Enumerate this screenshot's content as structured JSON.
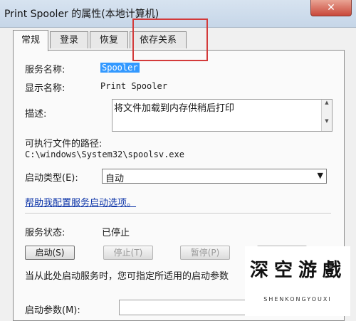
{
  "window": {
    "title": "Print Spooler 的属性(本地计算机)",
    "close_label": "✕"
  },
  "tabs": [
    "常规",
    "登录",
    "恢复",
    "依存关系"
  ],
  "fields": {
    "service_name_label": "服务名称:",
    "service_name_value": "Spooler",
    "display_name_label": "显示名称:",
    "display_name_value": "Print Spooler",
    "description_label": "描述:",
    "description_value": "将文件加载到内存供稍后打印",
    "exe_path_label": "可执行文件的路径:",
    "exe_path_value": "C:\\windows\\System32\\spoolsv.exe",
    "startup_type_label": "启动类型(E):",
    "startup_type_value": "自动",
    "help_link": "帮助我配置服务启动选项。",
    "status_label": "服务状态:",
    "status_value": "已停止"
  },
  "buttons": {
    "start": "启动(S)",
    "stop": "停止(T)",
    "pause": "暂停(P)",
    "resume": ""
  },
  "info_text": "当从此处启动服务时，您可指定所适用的启动参数",
  "start_params_label": "启动参数(M):",
  "start_params_value": "",
  "watermark": {
    "chars": [
      "深",
      "空",
      "游",
      "戲"
    ],
    "subtitle": "SHENKONGYOUXI"
  }
}
